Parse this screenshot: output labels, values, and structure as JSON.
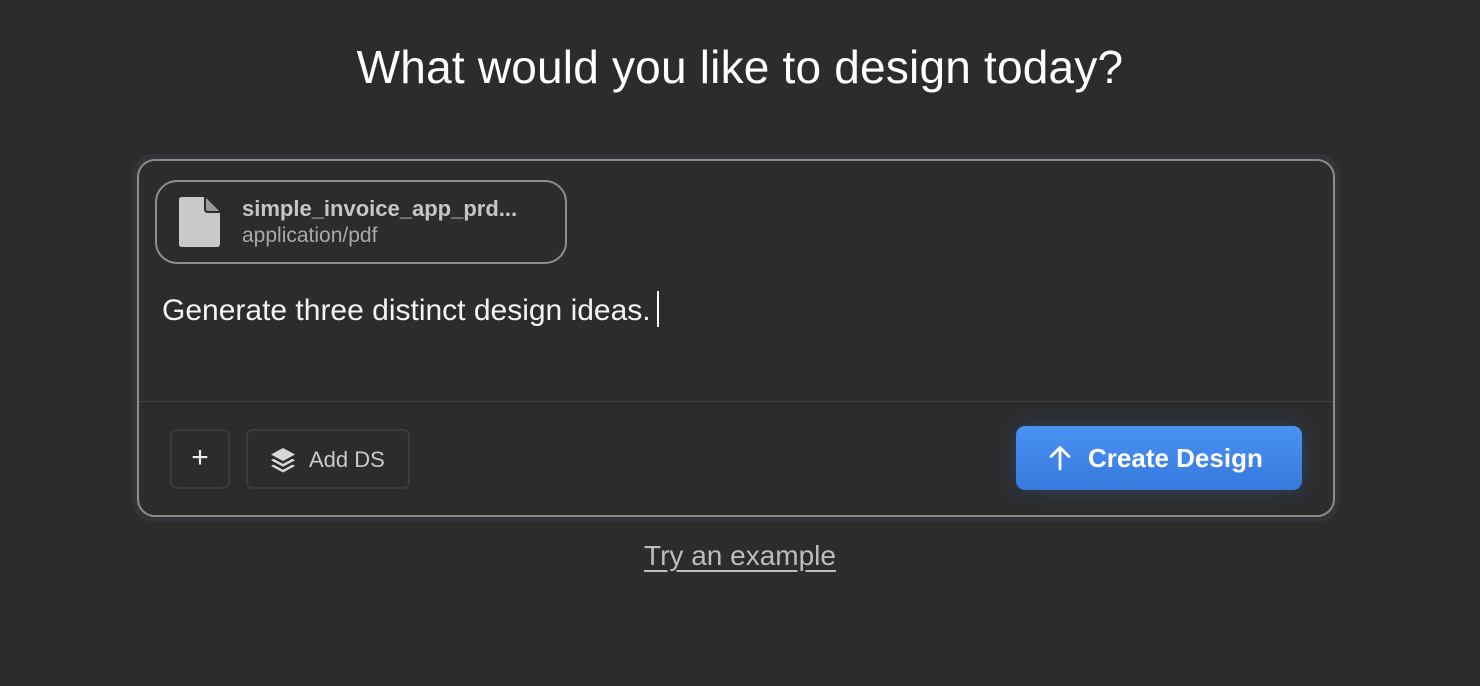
{
  "page": {
    "title": "What would you like to design today?"
  },
  "composer": {
    "attachment": {
      "name": "simple_invoice_app_prd...",
      "type": "application/pdf",
      "icon": "file-icon"
    },
    "prompt_text": "Generate three distinct design ideas.",
    "toolbar": {
      "plus_label": "+",
      "add_ds_label": "Add DS",
      "create_label": "Create Design"
    }
  },
  "footer": {
    "example_link": "Try an example"
  },
  "colors": {
    "background": "#2c2c2c",
    "accent": "#3f86ec",
    "border": "#8c8c8c"
  }
}
